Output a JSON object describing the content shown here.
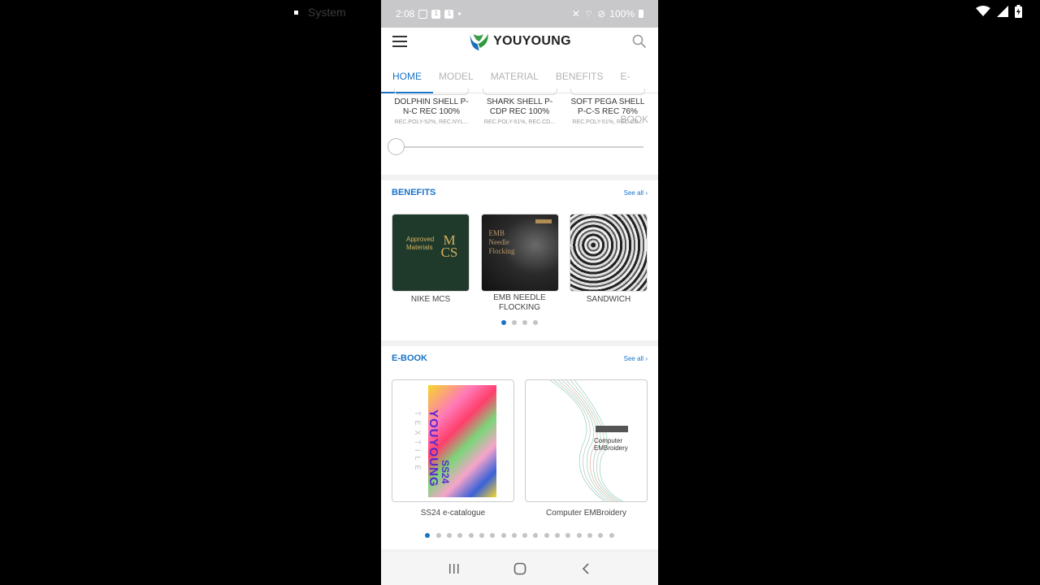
{
  "outer": {
    "system_label": "System"
  },
  "status": {
    "time": "2:08",
    "battery": "100%"
  },
  "app": {
    "brand": "YOUYOUNG",
    "brand_color": "#1a73c8"
  },
  "tabs": [
    {
      "label": "HOME",
      "active": true
    },
    {
      "label": "MODEL"
    },
    {
      "label": "MATERIAL"
    },
    {
      "label": "BENEFITS"
    },
    {
      "label": "E-BOOK"
    }
  ],
  "models": [
    {
      "name": "DOLPHIN SHELL P-N-C REC 100%",
      "sub": "REC.POLY-52%, REC.NYL..."
    },
    {
      "name": "SHARK SHELL P-CDP REC 100%",
      "sub": "REC.POLY-51%, REC.CD..."
    },
    {
      "name": "SOFT PEGA SHELL P-C-S REC 76%",
      "sub": "REC.POLY-51%, REC.CD..."
    }
  ],
  "slider": {
    "position": 0
  },
  "benefits": {
    "title": "BENEFITS",
    "see_all": "See all",
    "items": [
      {
        "label": "NIKE MCS",
        "image_text_1": "Approved",
        "image_text_2": "Materials",
        "image_mark": "MCS"
      },
      {
        "label": "EMB NEEDLE FLOCKING",
        "image_text_1": "EMB",
        "image_text_2": "Needle",
        "image_text_3": "Flocking"
      },
      {
        "label": "SANDWICH"
      }
    ],
    "dots": 4,
    "active_dot": 0
  },
  "ebook": {
    "title": "E-BOOK",
    "see_all": "See all",
    "items": [
      {
        "label": "SS24 e-catalogue",
        "cover_vertical": "YOUYOUNG",
        "cover_side": "TEXTILE",
        "cover_season": "SS24"
      },
      {
        "label": "Computer EMBroidery",
        "cover_line1": "Computer",
        "cover_line2": "EMBroidery"
      }
    ],
    "dots": 18,
    "active_dot": 0
  }
}
